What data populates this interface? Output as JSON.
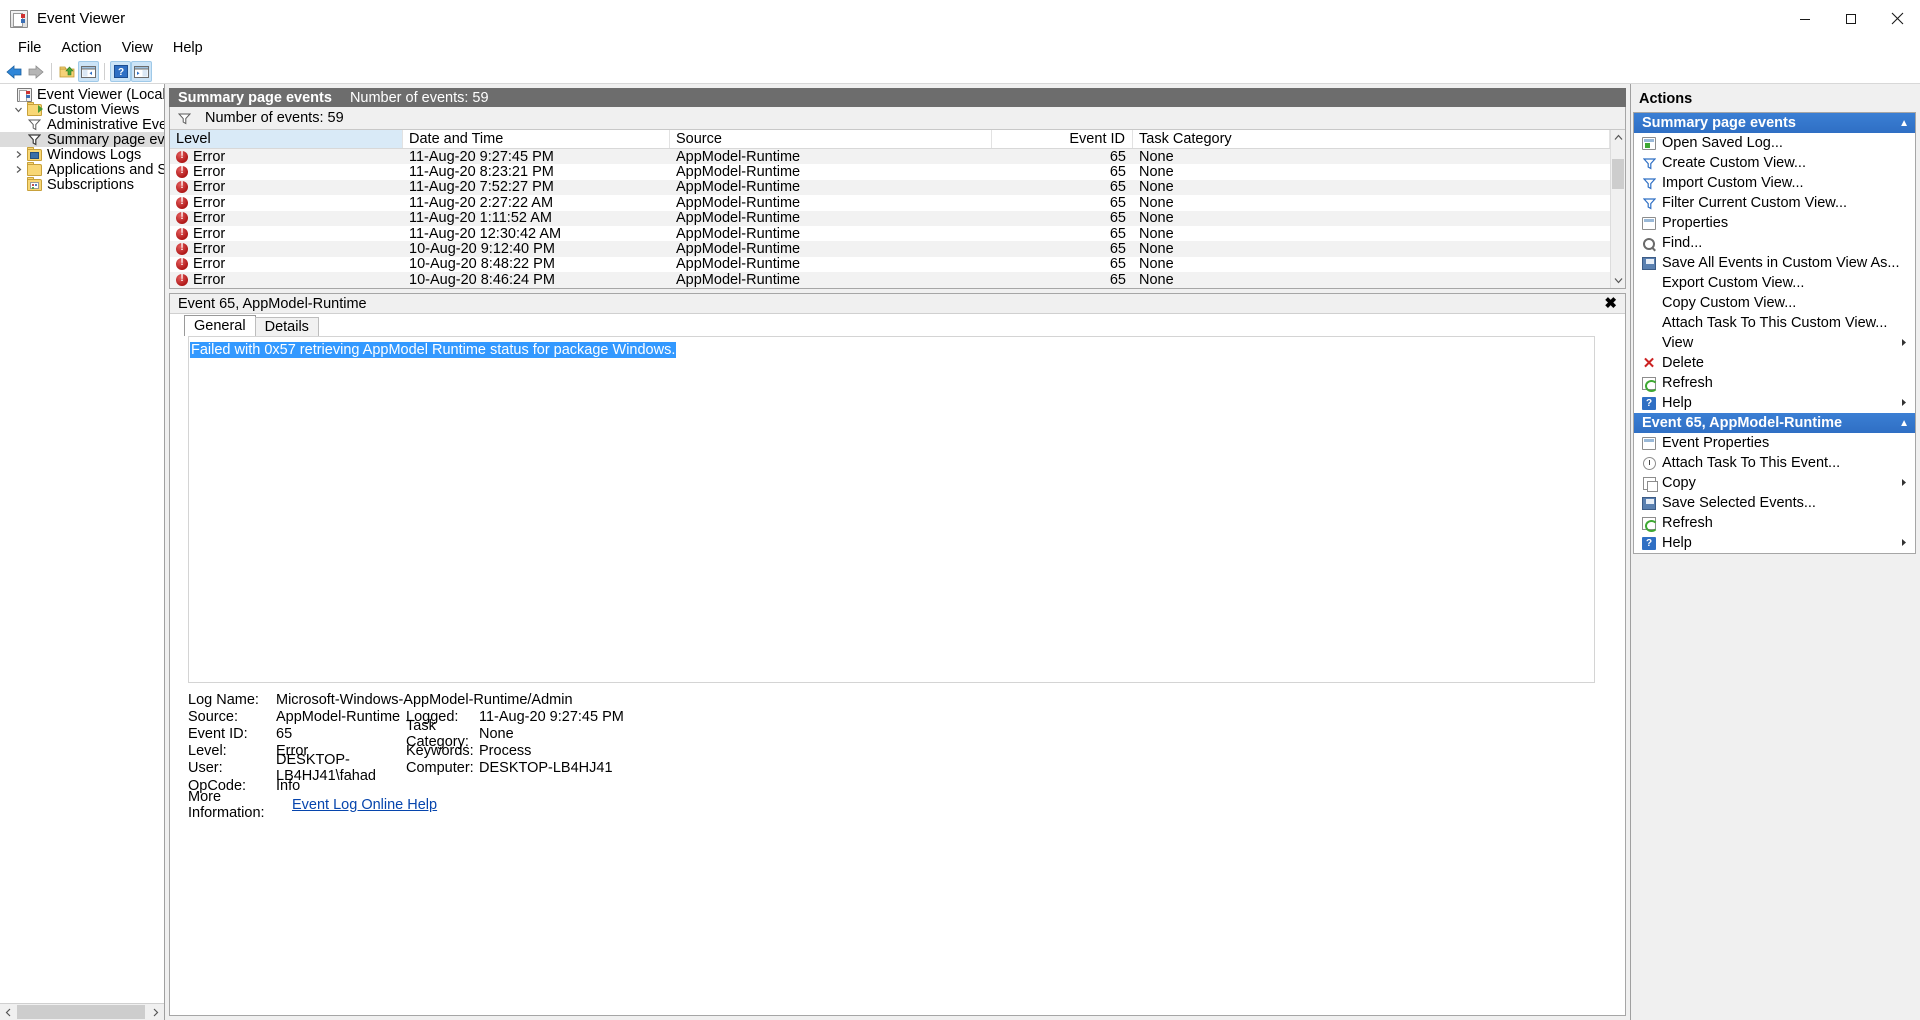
{
  "window": {
    "title": "Event Viewer",
    "minimize": "minimize",
    "maximize": "maximize",
    "close": "close"
  },
  "menubar": [
    "File",
    "Action",
    "View",
    "Help"
  ],
  "toolbar": {
    "back": "Back",
    "forward": "Forward",
    "up_folder": "Up one level",
    "show_hide_tree": "Show/Hide Console Tree",
    "help": "Help",
    "show_hide_action": "Show/Hide Action Pane"
  },
  "tree": {
    "root": "Event Viewer (Local)",
    "items": [
      {
        "label": "Custom Views",
        "indent": 1,
        "twisty": "expanded",
        "icon": "folder-green"
      },
      {
        "label": "Administrative Events",
        "indent": 2,
        "twisty": "none",
        "icon": "funnel"
      },
      {
        "label": "Summary page events",
        "indent": 2,
        "twisty": "none",
        "icon": "funnel",
        "selected": true
      },
      {
        "label": "Windows Logs",
        "indent": 1,
        "twisty": "collapsed",
        "icon": "folder-blue"
      },
      {
        "label": "Applications and Services Lo",
        "indent": 1,
        "twisty": "collapsed",
        "icon": "folder"
      },
      {
        "label": "Subscriptions",
        "indent": 1,
        "twisty": "none",
        "icon": "folder-sub"
      }
    ]
  },
  "list": {
    "band_title": "Summary page events",
    "band_count": "Number of events: 59",
    "filter_count": "Number of events: 59",
    "columns": [
      "Level",
      "Date and Time",
      "Source",
      "Event ID",
      "Task Category"
    ],
    "rows": [
      {
        "level": "Error",
        "date": "11-Aug-20 9:27:45 PM",
        "source": "AppModel-Runtime",
        "event_id": "65",
        "task": "None"
      },
      {
        "level": "Error",
        "date": "11-Aug-20 8:23:21 PM",
        "source": "AppModel-Runtime",
        "event_id": "65",
        "task": "None"
      },
      {
        "level": "Error",
        "date": "11-Aug-20 7:52:27 PM",
        "source": "AppModel-Runtime",
        "event_id": "65",
        "task": "None"
      },
      {
        "level": "Error",
        "date": "11-Aug-20 2:27:22 AM",
        "source": "AppModel-Runtime",
        "event_id": "65",
        "task": "None"
      },
      {
        "level": "Error",
        "date": "11-Aug-20 1:11:52 AM",
        "source": "AppModel-Runtime",
        "event_id": "65",
        "task": "None"
      },
      {
        "level": "Error",
        "date": "11-Aug-20 12:30:42 AM",
        "source": "AppModel-Runtime",
        "event_id": "65",
        "task": "None"
      },
      {
        "level": "Error",
        "date": "10-Aug-20 9:12:40 PM",
        "source": "AppModel-Runtime",
        "event_id": "65",
        "task": "None"
      },
      {
        "level": "Error",
        "date": "10-Aug-20 8:48:22 PM",
        "source": "AppModel-Runtime",
        "event_id": "65",
        "task": "None"
      },
      {
        "level": "Error",
        "date": "10-Aug-20 8:46:24 PM",
        "source": "AppModel-Runtime",
        "event_id": "65",
        "task": "None"
      }
    ]
  },
  "detail": {
    "header": "Event 65, AppModel-Runtime",
    "close_label": "✖",
    "tabs": [
      {
        "label": "General",
        "active": true
      },
      {
        "label": "Details",
        "active": false
      }
    ],
    "message": "Failed with 0x57 retrieving AppModel Runtime status for package Windows.",
    "fields": [
      {
        "label": "Log Name:",
        "value": "Microsoft-Windows-AppModel-Runtime/Admin",
        "label2": "",
        "value2": ""
      },
      {
        "label": "Source:",
        "value": "AppModel-Runtime",
        "label2": "Logged:",
        "value2": "11-Aug-20 9:27:45 PM"
      },
      {
        "label": "Event ID:",
        "value": "65",
        "label2": "Task Category:",
        "value2": "None"
      },
      {
        "label": "Level:",
        "value": "Error",
        "label2": "Keywords:",
        "value2": "Process"
      },
      {
        "label": "User:",
        "value": "DESKTOP-LB4HJ41\\fahad",
        "label2": "Computer:",
        "value2": "DESKTOP-LB4HJ41"
      },
      {
        "label": "OpCode:",
        "value": "Info",
        "label2": "",
        "value2": ""
      }
    ],
    "more_info_label": "More Information:",
    "more_info_link": "Event Log Online Help"
  },
  "actions": {
    "title": "Actions",
    "sections": [
      {
        "title": "Summary page events",
        "collapse_glyph": "▲",
        "items": [
          {
            "label": "Open Saved Log...",
            "icon": "open-log-icon",
            "submenu": false
          },
          {
            "label": "Create Custom View...",
            "icon": "funnel-icon",
            "submenu": false
          },
          {
            "label": "Import Custom View...",
            "icon": "funnel-icon",
            "submenu": false
          },
          {
            "label": "Filter Current Custom View...",
            "icon": "funnel-icon",
            "submenu": false
          },
          {
            "label": "Properties",
            "icon": "properties-icon",
            "submenu": false
          },
          {
            "label": "Find...",
            "icon": "find-icon",
            "submenu": false
          },
          {
            "label": "Save All Events in Custom View As...",
            "icon": "save-icon",
            "submenu": false
          },
          {
            "label": "Export Custom View...",
            "icon": "none",
            "submenu": false
          },
          {
            "label": "Copy Custom View...",
            "icon": "none",
            "submenu": false
          },
          {
            "label": "Attach Task To This Custom View...",
            "icon": "none",
            "submenu": false
          },
          {
            "label": "View",
            "icon": "none",
            "submenu": true
          },
          {
            "label": "Delete",
            "icon": "delete-icon",
            "submenu": false
          },
          {
            "label": "Refresh",
            "icon": "refresh-icon",
            "submenu": false
          },
          {
            "label": "Help",
            "icon": "help-icon",
            "submenu": true
          }
        ]
      },
      {
        "title": "Event 65, AppModel-Runtime",
        "collapse_glyph": "▲",
        "items": [
          {
            "label": "Event Properties",
            "icon": "properties-icon",
            "submenu": false
          },
          {
            "label": "Attach Task To This Event...",
            "icon": "clock-icon",
            "submenu": false
          },
          {
            "label": "Copy",
            "icon": "copy-icon",
            "submenu": true
          },
          {
            "label": "Save Selected Events...",
            "icon": "save-icon",
            "submenu": false
          },
          {
            "label": "Refresh",
            "icon": "refresh-icon",
            "submenu": false
          },
          {
            "label": "Help",
            "icon": "help-icon",
            "submenu": true
          }
        ]
      }
    ]
  },
  "colors": {
    "accent": "#2f6fc4",
    "band": "#6d6d6d",
    "selection": "#3399ff",
    "error": "#b01818",
    "link": "#0645ad"
  }
}
